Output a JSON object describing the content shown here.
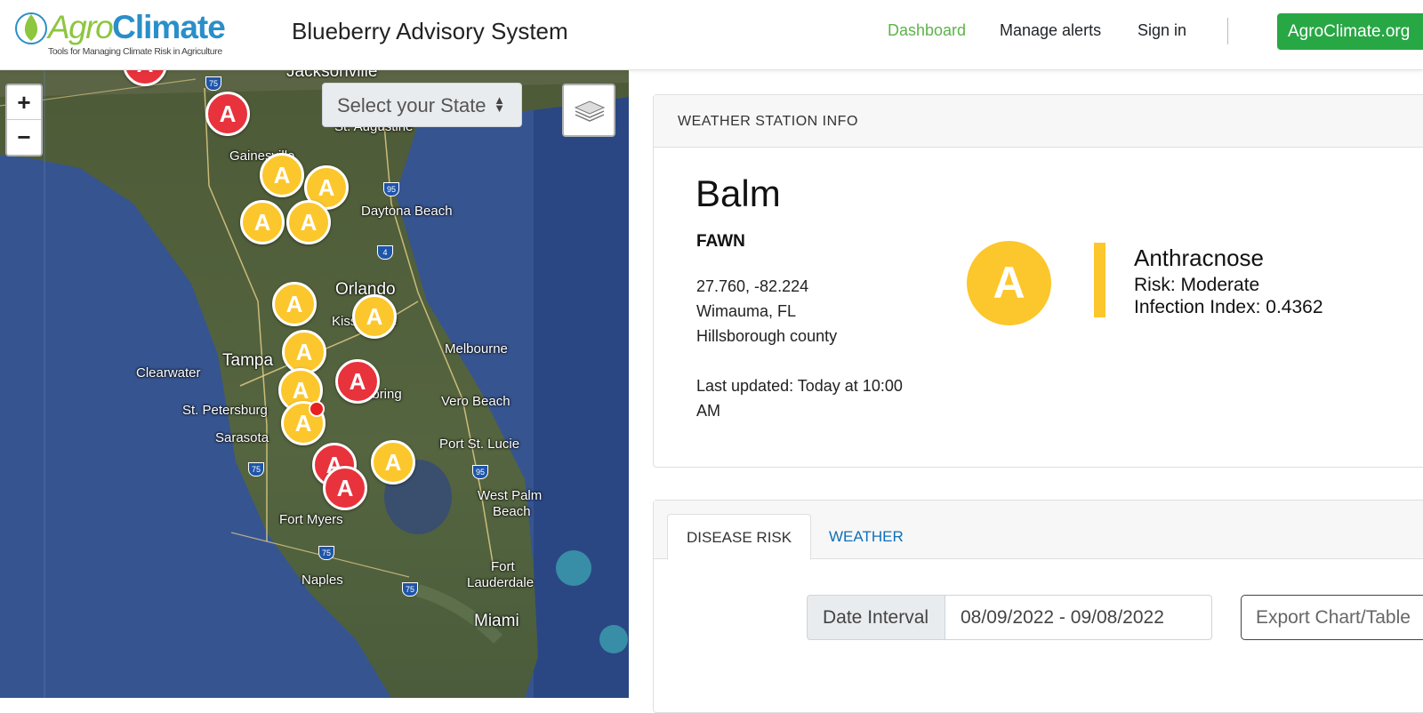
{
  "header": {
    "logo": {
      "agro": "Agro",
      "climate": "Climate",
      "tagline": "Tools for Managing Climate Risk in Agriculture"
    },
    "app_title": "Blueberry Advisory System",
    "nav": {
      "dashboard": "Dashboard",
      "manage_alerts": "Manage alerts",
      "sign_in": "Sign in"
    },
    "external_button": "AgroClimate.org"
  },
  "map": {
    "zoom_in": "+",
    "zoom_out": "−",
    "state_select": {
      "selected": "Select your State"
    },
    "cities": [
      "Jacksonville",
      "St. Augustine",
      "Gainesville",
      "Daytona Beach",
      "Orlando",
      "Kissimmee",
      "Melbourne",
      "Tampa",
      "Clearwater",
      "St. Petersburg",
      "Sarasota",
      "Vero Beach",
      "Port St. Lucie",
      "West Palm",
      "Beach",
      "Fort Myers",
      "Fort",
      "Lauderdale",
      "Naples",
      "Miami",
      "Sebring"
    ],
    "highways": [
      "75",
      "95",
      "4",
      "95",
      "75",
      "75",
      "75"
    ],
    "marker_letter": "A",
    "marker_colors": {
      "moderate": "#fcc72c",
      "high": "#e8323c"
    }
  },
  "station_card": {
    "header": "WEATHER STATION INFO",
    "name": "Balm",
    "network": "FAWN",
    "coords": "27.760, -82.224",
    "location": "Wimauma, FL",
    "county": "Hillsborough county",
    "last_updated_1": "Last updated: Today at 10:00",
    "last_updated_2": "AM",
    "risk": {
      "letter": "A",
      "disease": "Anthracnose",
      "risk_text": "Risk: Moderate",
      "index_text": "Infection Index: 0.4362",
      "color": "#fcc72c"
    }
  },
  "tabs_card": {
    "tabs": [
      "DISEASE RISK",
      "WEATHER"
    ],
    "date_label": "Date Interval",
    "date_value": "08/09/2022 - 09/08/2022",
    "export_label": "Export Chart/Table"
  }
}
